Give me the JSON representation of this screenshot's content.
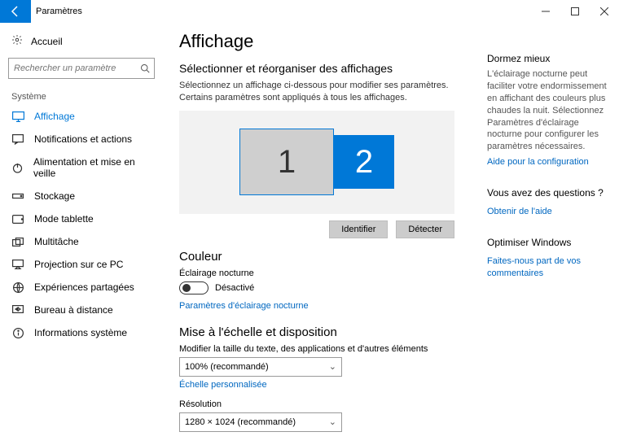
{
  "window": {
    "title": "Paramètres"
  },
  "sidebar": {
    "home": "Accueil",
    "search_placeholder": "Rechercher un paramètre",
    "category": "Système",
    "items": [
      {
        "label": "Affichage"
      },
      {
        "label": "Notifications et actions"
      },
      {
        "label": "Alimentation et mise en veille"
      },
      {
        "label": "Stockage"
      },
      {
        "label": "Mode tablette"
      },
      {
        "label": "Multitâche"
      },
      {
        "label": "Projection sur ce PC"
      },
      {
        "label": "Expériences partagées"
      },
      {
        "label": "Bureau à distance"
      },
      {
        "label": "Informations système"
      }
    ]
  },
  "main": {
    "title": "Affichage",
    "select_head": "Sélectionner et réorganiser des affichages",
    "select_desc": "Sélectionnez un affichage ci-dessous pour modifier ses paramètres. Certains paramètres sont appliqués à tous les affichages.",
    "monitor1": "1",
    "monitor2": "2",
    "identify": "Identifier",
    "detect": "Détecter",
    "color_head": "Couleur",
    "nightlight_label": "Éclairage nocturne",
    "nightlight_state": "Désactivé",
    "nightlight_link": "Paramètres d'éclairage nocturne",
    "scale_head": "Mise à l'échelle et disposition",
    "scale_label": "Modifier la taille du texte, des applications et d'autres éléments",
    "scale_value": "100% (recommandé)",
    "custom_scale_link": "Échelle personnalisée",
    "resolution_label": "Résolution",
    "resolution_value": "1280 × 1024 (recommandé)"
  },
  "right": {
    "b1_head": "Dormez mieux",
    "b1_text": "L'éclairage nocturne peut faciliter votre endormissement en affichant des couleurs plus chaudes la nuit. Sélectionnez Paramètres d'éclairage nocturne pour configurer les paramètres nécessaires.",
    "b1_link": "Aide pour la configuration",
    "b2_head": "Vous avez des questions ?",
    "b2_link": "Obtenir de l'aide",
    "b3_head": "Optimiser Windows",
    "b3_link": "Faites-nous part de vos commentaires"
  }
}
